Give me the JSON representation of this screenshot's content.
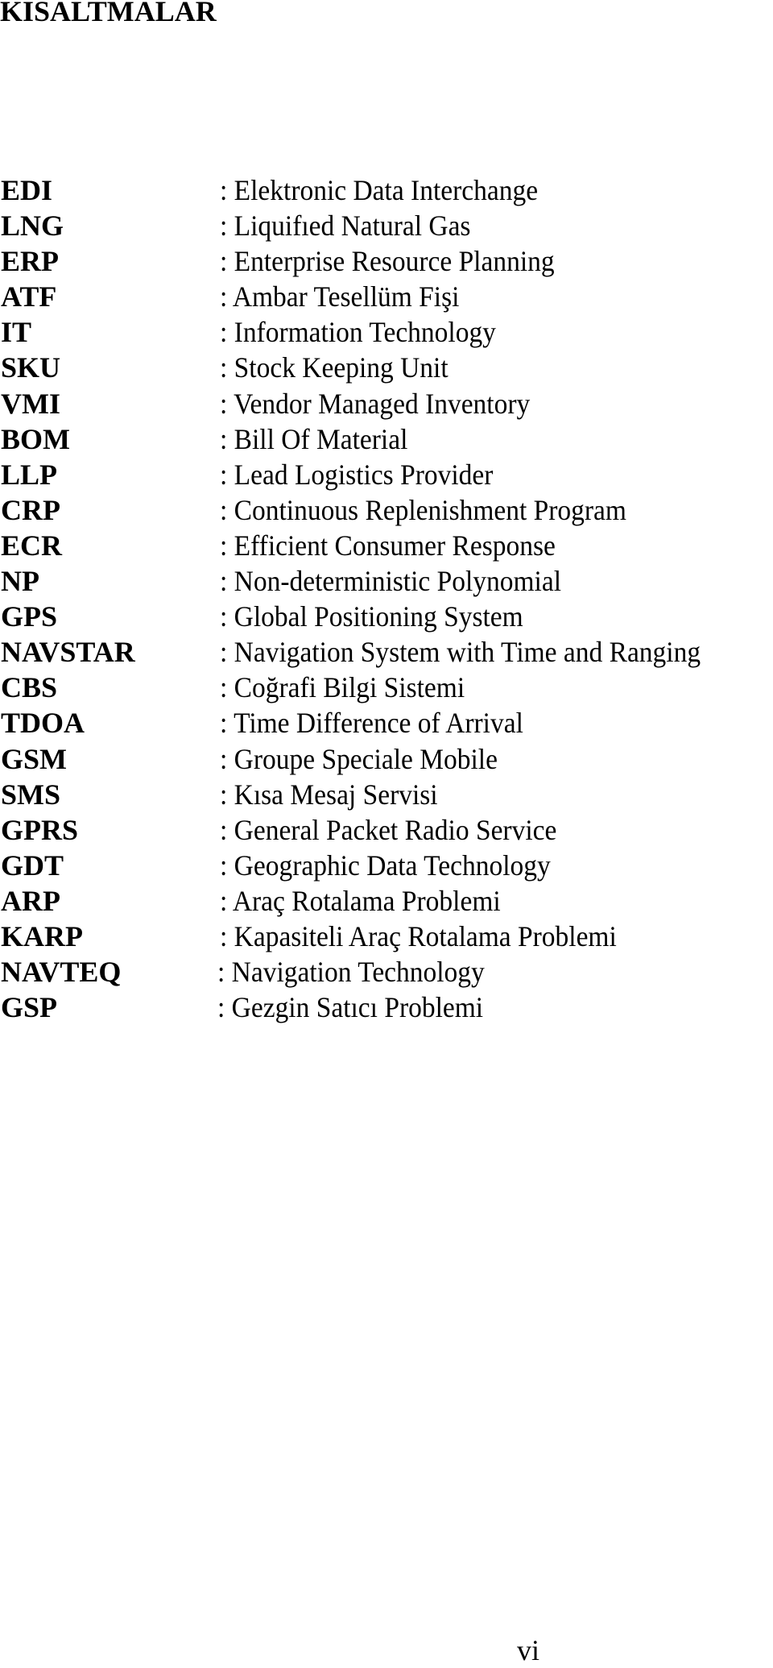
{
  "document": {
    "title": "KISALTMALAR",
    "page_number": "vi"
  },
  "abbreviations": [
    {
      "term": "EDI",
      "definition": ": Elektronic Data Interchange"
    },
    {
      "term": "LNG",
      "definition": ": Liquifıed Natural Gas"
    },
    {
      "term": "ERP",
      "definition": ": Enterprise Resource Planning"
    },
    {
      "term": "ATF",
      "definition": ": Ambar Tesellüm Fişi"
    },
    {
      "term": "IT",
      "definition": ": Information Technology"
    },
    {
      "term": "SKU",
      "definition": ": Stock Keeping Unit"
    },
    {
      "term": "VMI",
      "definition": ": Vendor Managed Inventory"
    },
    {
      "term": "BOM",
      "definition": ": Bill Of Material"
    },
    {
      "term": "LLP",
      "definition": ": Lead Logistics Provider"
    },
    {
      "term": "CRP",
      "definition": ": Continuous Replenishment Program"
    },
    {
      "term": "ECR",
      "definition": ": Efficient Consumer Response"
    },
    {
      "term": "NP",
      "definition": ": Non-deterministic Polynomial"
    },
    {
      "term": "GPS",
      "definition": ": Global Positioning System"
    },
    {
      "term": "NAVSTAR",
      "definition": ": Navigation System with Time and Ranging"
    },
    {
      "term": "CBS",
      "definition": ": Coğrafi Bilgi Sistemi"
    },
    {
      "term": "TDOA",
      "definition": ": Time Difference of Arrival"
    },
    {
      "term": "GSM",
      "definition": ": Groupe Speciale Mobile"
    },
    {
      "term": "SMS",
      "definition": ": Kısa Mesaj Servisi"
    },
    {
      "term": "GPRS",
      "definition": ": General Packet Radio Service"
    },
    {
      "term": "GDT",
      "definition": ": Geographic Data Technology"
    },
    {
      "term": "ARP",
      "definition": ": Araç Rotalama Problemi"
    },
    {
      "term": "KARP",
      "definition": ": Kapasiteli Araç Rotalama Problemi"
    },
    {
      "term": "NAVTEQ",
      "definition": ": Navigation Technology"
    },
    {
      "term": "GSP",
      "definition": ": Gezgin Satıcı Problemi"
    }
  ]
}
